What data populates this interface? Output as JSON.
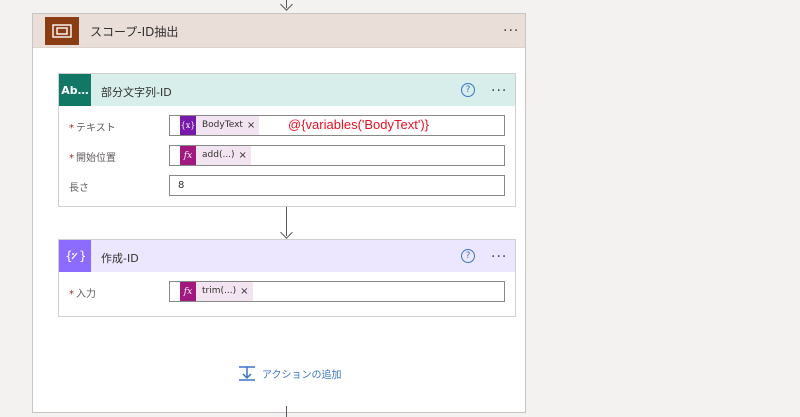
{
  "scope": {
    "title": "スコープ-ID抽出",
    "more": "···"
  },
  "card_substring": {
    "icon_text": "Ab…",
    "title": "部分文字列-ID",
    "more": "···",
    "help": "?",
    "fields": [
      {
        "label": "テキスト",
        "required": "*",
        "token": "BodyText",
        "token_icon": "{x}",
        "remove": "×"
      },
      {
        "label": "開始位置",
        "required": "*",
        "token": "add(...)",
        "token_icon": "fx",
        "remove": "×"
      },
      {
        "label": "長さ",
        "value": "8"
      }
    ]
  },
  "annotation": "@{variables('BodyText')}",
  "card_compose": {
    "title": "作成-ID",
    "more": "···",
    "help": "?",
    "fields": [
      {
        "label": "入力",
        "required": "*",
        "token": "trim(...)",
        "token_icon": "fx",
        "remove": "×"
      }
    ]
  },
  "add_action": {
    "label": "アクションの追加"
  },
  "colors": {
    "scope_icon": "#8a3c13",
    "scope_header": "#eadfd8",
    "substring_icon": "#117865",
    "substring_header": "#d7eeea",
    "compose_icon": "#8c6cff",
    "compose_header": "#ece6ff",
    "variable_token": "#7719aa",
    "expression_token": "#a1197f",
    "annotation": "#e81123",
    "link": "#3a74c5"
  }
}
